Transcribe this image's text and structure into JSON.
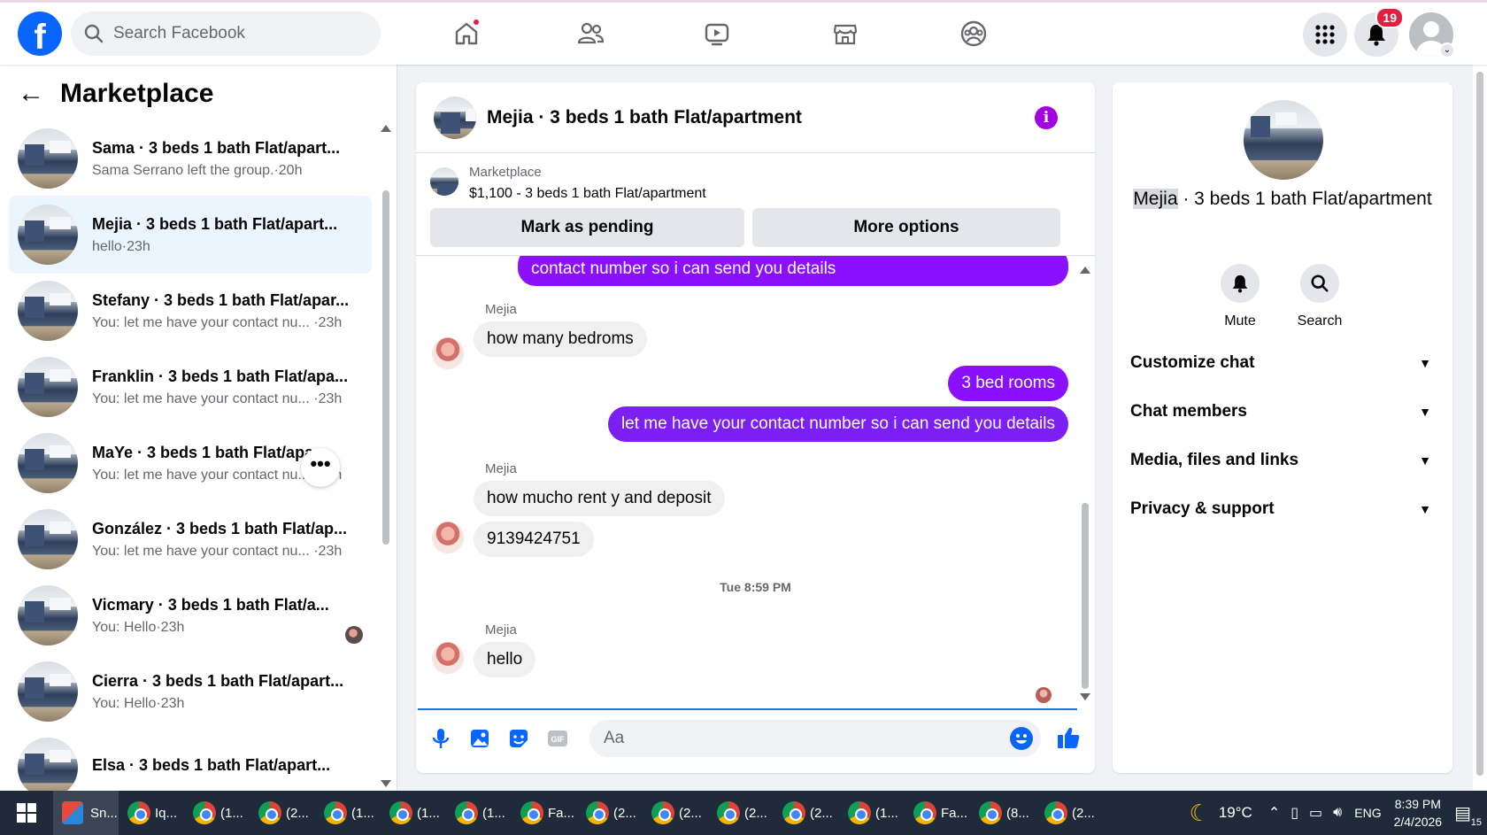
{
  "topbar": {
    "logo": "f",
    "search_placeholder": "Search Facebook",
    "notification_count": "19",
    "icons": [
      "home-icon",
      "friends-icon",
      "watch-icon",
      "marketplace-icon",
      "groups-icon",
      "menu-grid-icon",
      "bell-icon",
      "account-icon"
    ]
  },
  "left": {
    "title": "Marketplace",
    "conversations": [
      {
        "title": "Sama · 3 beds 1 bath Flat/apart...",
        "subtitle": "Sama Serrano left the group.·20h"
      },
      {
        "title": "Mejia · 3 beds 1 bath Flat/apart...",
        "subtitle": "hello·23h"
      },
      {
        "title": "Stefany · 3 beds 1 bath Flat/apar...",
        "subtitle": "You: let me have your contact nu... ·23h"
      },
      {
        "title": "Franklin · 3 beds 1 bath Flat/apa...",
        "subtitle": "You: let me have your contact nu... ·23h"
      },
      {
        "title": "MaYe · 3 beds 1 bath Flat/apa...",
        "subtitle": "You: let me have your contact nu... ·23h"
      },
      {
        "title": "González · 3 beds 1 bath Flat/ap...",
        "subtitle": "You: let me have your contact nu... ·23h"
      },
      {
        "title": "Vicmary · 3 beds 1 bath Flat/a...",
        "subtitle": "You: Hello·23h"
      },
      {
        "title": "Cierra · 3 beds 1 bath Flat/apart...",
        "subtitle": "You: Hello·23h"
      },
      {
        "title": "Elsa · 3 beds 1 bath Flat/apart...",
        "subtitle": ""
      }
    ],
    "more_label": "•••"
  },
  "chat": {
    "title": "Mejia · 3 beds 1 bath Flat/apartment",
    "info": "i",
    "marketplace_label": "Marketplace",
    "listing": "$1,100 - 3 beds 1 bath Flat/apartment",
    "mark_pending": "Mark as pending",
    "more_options": "More options",
    "messages": {
      "out_top": "contact number so i can send you details",
      "sender": "Mejia",
      "in_1": "how many bedroms",
      "out_1": "3 bed rooms",
      "out_2": "let me have your contact number so i can send you details",
      "in_2": "how mucho rent y and deposit",
      "in_3": "9139424751",
      "timestamp": "Tue 8:59 PM",
      "in_4": "hello"
    },
    "composer_placeholder": "Aa"
  },
  "right": {
    "title_highlight": "Mejia",
    "title_rest": " · 3 beds 1 bath Flat/apartment",
    "mute": "Mute",
    "search": "Search",
    "sections": [
      "Customize chat",
      "Chat members",
      "Media, files and links",
      "Privacy & support"
    ]
  },
  "taskbar": {
    "items": [
      "Sn...",
      "Iq...",
      "(1...",
      "(2...",
      "(1...",
      "(1...",
      "(1...",
      "Fa...",
      "(2...",
      "(2...",
      "(2...",
      "(2...",
      "(1...",
      "Fa...",
      "(8...",
      "(2..."
    ],
    "temperature": "19°C",
    "language": "ENG",
    "time": "8:39 PM",
    "date": "2/4/2026",
    "notif_count": "15"
  },
  "colors": {
    "brand": "#0866ff",
    "message_out": "#8a10ff",
    "info": "#a200e0",
    "badge": "#e41e3f"
  }
}
